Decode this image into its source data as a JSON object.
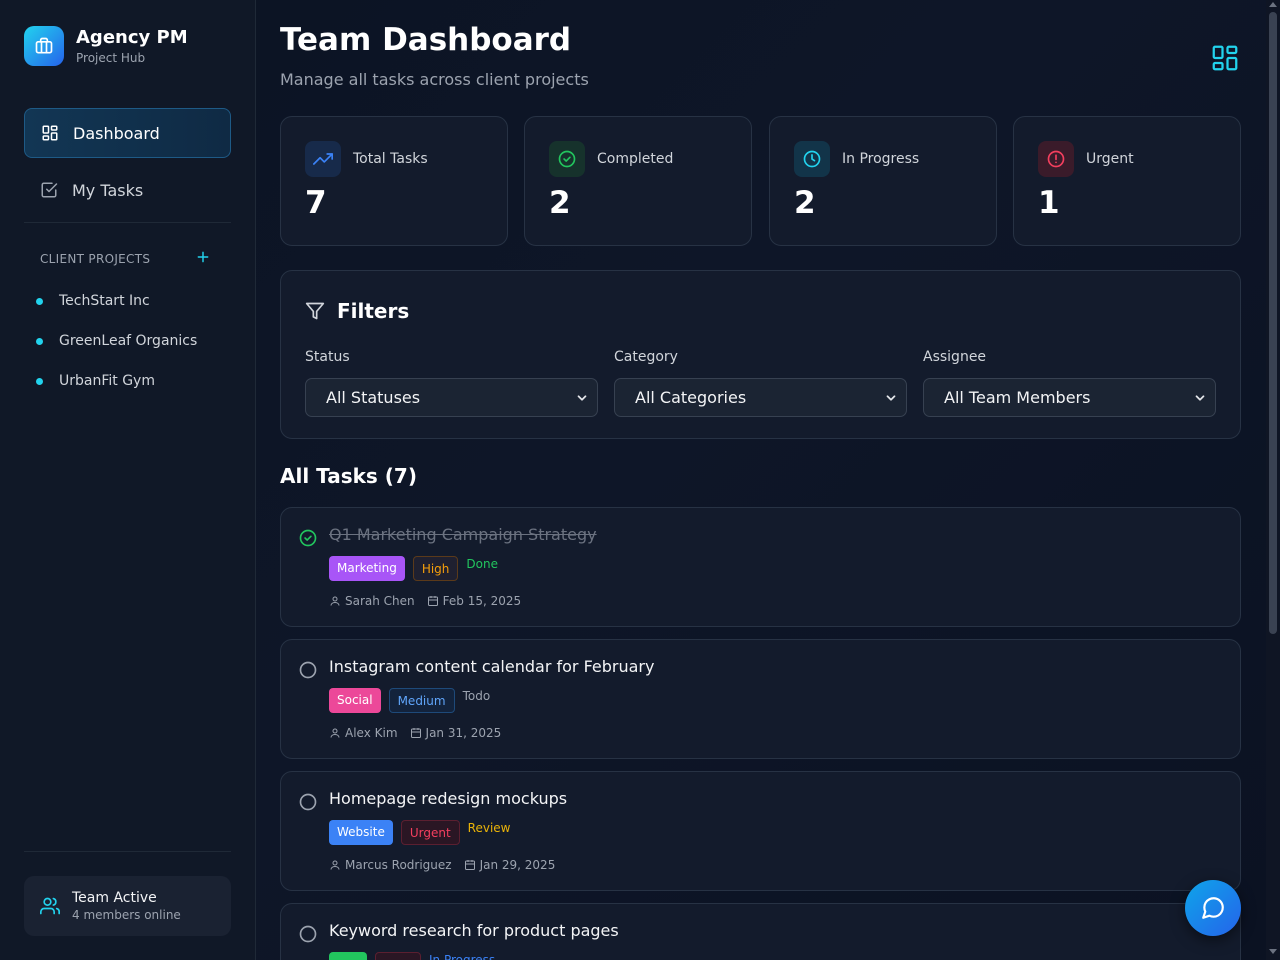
{
  "brand": {
    "title": "Agency PM",
    "subtitle": "Project Hub"
  },
  "nav": {
    "dashboard_label": "Dashboard",
    "my_tasks_label": "My Tasks"
  },
  "projects": {
    "section_label": "CLIENT PROJECTS",
    "add_icon": "plus-icon",
    "items": [
      {
        "label": "TechStart Inc"
      },
      {
        "label": "GreenLeaf Organics"
      },
      {
        "label": "UrbanFit Gym"
      }
    ]
  },
  "team": {
    "title": "Team Active",
    "subtitle": "4 members online"
  },
  "header": {
    "title": "Team Dashboard",
    "subtitle": "Manage all tasks across client projects"
  },
  "stats": [
    {
      "label": "Total Tasks",
      "value": "7",
      "icon": "trending-up-icon",
      "color": "#3b82f6"
    },
    {
      "label": "Completed",
      "value": "2",
      "icon": "check-circle-icon",
      "color": "#22c55e"
    },
    {
      "label": "In Progress",
      "value": "2",
      "icon": "clock-icon",
      "color": "#22d3ee"
    },
    {
      "label": "Urgent",
      "value": "1",
      "icon": "alert-circle-icon",
      "color": "#f43f5e"
    }
  ],
  "filters": {
    "title": "Filters",
    "status": {
      "label": "Status",
      "value": "All Statuses"
    },
    "category": {
      "label": "Category",
      "value": "All Categories"
    },
    "assignee": {
      "label": "Assignee",
      "value": "All Team Members"
    }
  },
  "tasks_heading": "All Tasks (7)",
  "tasks": [
    {
      "title": "Q1 Marketing Campaign Strategy",
      "done": true,
      "category": "Marketing",
      "category_color": "#a855f7",
      "priority": "High",
      "priority_color": "#f59e0b",
      "status": "Done",
      "status_color": "#22c55e",
      "assignee": "Sarah Chen",
      "date": "Feb 15, 2025"
    },
    {
      "title": "Instagram content calendar for February",
      "done": false,
      "category": "Social",
      "category_color": "#ec4899",
      "priority": "Medium",
      "priority_color": "#60a5fa",
      "status": "Todo",
      "status_color": "#9ca3af",
      "assignee": "Alex Kim",
      "date": "Jan 31, 2025"
    },
    {
      "title": "Homepage redesign mockups",
      "done": false,
      "category": "Website",
      "category_color": "#3b82f6",
      "priority": "Urgent",
      "priority_color": "#f43f5e",
      "status": "Review",
      "status_color": "#eab308",
      "assignee": "Marcus Rodriguez",
      "date": "Jan 29, 2025"
    },
    {
      "title": "Keyword research for product pages",
      "done": false,
      "category": "",
      "category_color": "#22c55e",
      "priority": "",
      "priority_color": "#9ca3af",
      "status": "In Progress",
      "status_color": "#3b82f6",
      "assignee": "",
      "date": ""
    }
  ]
}
